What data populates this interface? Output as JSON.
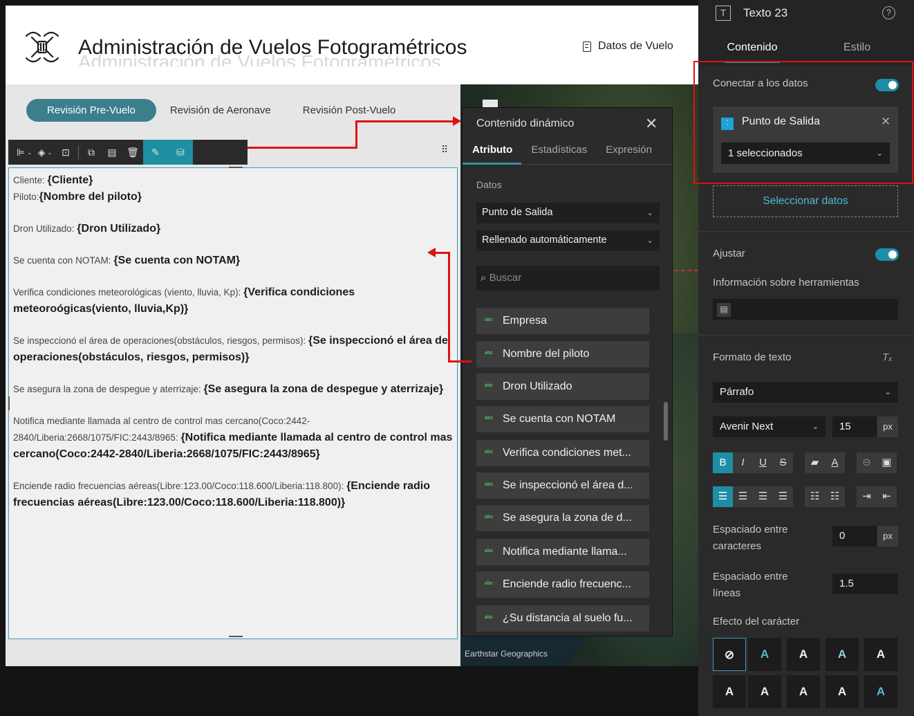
{
  "header": {
    "title": "Administración de Vuelos Fotogramétricos",
    "nav_link": "Datos de Vuelo"
  },
  "tabs": [
    {
      "label": "Revisión Pre-Vuelo",
      "active": true
    },
    {
      "label": "Revisión de Aeronave",
      "active": false
    },
    {
      "label": "Revisión Post-Vuelo",
      "active": false
    }
  ],
  "map": {
    "attribution": "Earthstar Geographics"
  },
  "editor": {
    "paragraphs": [
      {
        "label": "Cliente: ",
        "field": "{Cliente}"
      },
      {
        "label": "Piloto:",
        "field": "{Nombre del piloto}"
      },
      {
        "label": "Dron Utilizado: ",
        "field": "{Dron Utilizado}"
      },
      {
        "label": "Se cuenta con NOTAM: ",
        "field": "{Se cuenta con NOTAM}"
      },
      {
        "label": "Verifica condiciones meteorológicas (viento, lluvia, Kp): ",
        "field": "{Verifica condiciones meteoroógicas(viento, lluvia,Kp)}"
      },
      {
        "label": "Se inspeccionó el área de operaciones(obstáculos, riesgos, permisos): ",
        "field": "{Se inspeccionó el área de operaciones(obstáculos, riesgos, permisos)}"
      },
      {
        "label": "Se asegura la zona de despegue y aterrizaje: ",
        "field": "{Se asegura la zona de despegue y aterrizaje}"
      },
      {
        "label": "Notifica mediante llamada al centro de control mas cercano(Coco:2442-2840/Liberia:2668/1075/FIC:2443/8965: ",
        "field": "{Notifica mediante llamada al centro de control mas cercano(Coco:2442-2840/Liberia:2668/1075/FIC:2443/8965}"
      },
      {
        "label": "Enciende radio frecuencias aéreas(Libre:123.00/Coco:118.600/Liberia:118.800): ",
        "field": "{Enciende radio frecuencias aéreas(Libre:123.00/Coco:118.600/Liberia:118.800)}"
      }
    ]
  },
  "dynamic_panel": {
    "title": "Contenido dinámico",
    "tabs": [
      "Atributo",
      "Estadísticas",
      "Expresión"
    ],
    "active_tab": "Atributo",
    "datos_label": "Datos",
    "source_select": "Punto de Salida",
    "mode_select": "Rellenado automáticamente",
    "search_placeholder": "Buscar",
    "field_type_icon": "abc",
    "fields": [
      "Empresa",
      "Nombre del piloto",
      "Dron Utilizado",
      "Se cuenta con NOTAM",
      "Verifica condiciones met...",
      "Se inspeccionó el área d...",
      "Se asegura la zona de d...",
      "Notifica mediante llama...",
      "Enciende radio frecuenc...",
      "¿Su distancia al suelo fu..."
    ]
  },
  "right_panel": {
    "title": "Texto 23",
    "tabs": {
      "content": "Contenido",
      "style": "Estilo"
    },
    "connect_label": "Conectar a los datos",
    "connect_enabled": true,
    "data_source": "Punto de Salida",
    "selection": "1 seleccionados",
    "select_data": "Seleccionar datos",
    "fit_label": "Ajustar",
    "fit_enabled": true,
    "tooltip_label": "Información sobre herramientas",
    "format_label": "Formato de texto",
    "paragraph_style": "Párrafo",
    "font": "Avenir Next",
    "font_size": "15",
    "unit_px": "px",
    "letter_spacing_label": "Espaciado entre caracteres",
    "letter_spacing": "0",
    "line_spacing_label": "Espaciado entre líneas",
    "line_spacing": "1.5",
    "effect_label": "Efecto del carácter",
    "effect_glyph": "A"
  },
  "colors": {
    "accent": "#1e8ea6",
    "tab_active": "#3c7f8c",
    "annotation": "#e01010"
  }
}
